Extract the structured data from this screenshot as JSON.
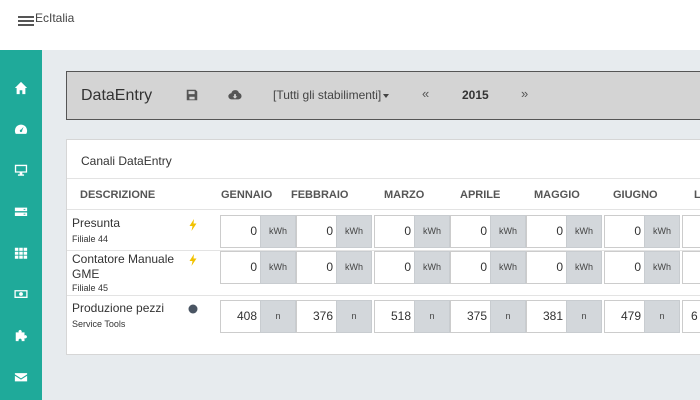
{
  "header": {
    "app_title": "EcItalia"
  },
  "sidebar": {
    "items": [
      {
        "icon": "home-icon"
      },
      {
        "icon": "dashboard-icon"
      },
      {
        "icon": "monitor-icon"
      },
      {
        "icon": "server-icon"
      },
      {
        "icon": "grid-icon"
      },
      {
        "icon": "money-icon"
      },
      {
        "icon": "puzzle-icon"
      },
      {
        "icon": "envelope-icon"
      }
    ]
  },
  "toolbar": {
    "title": "DataEntry",
    "save_icon": "save-icon",
    "download_icon": "cloud-download-icon",
    "plant_select": "[Tutti gli stabilimenti]",
    "prev": "«",
    "year": "2015",
    "next": "»"
  },
  "panel": {
    "title": "Canali DataEntry",
    "columns": [
      "DESCRIZIONE",
      "GENNAIO",
      "FEBBRAIO",
      "MARZO",
      "APRILE",
      "MAGGIO",
      "GIUGNO",
      "L"
    ],
    "rows": [
      {
        "name": "Presunta",
        "sub": "Filiale 44",
        "icon": "lightning-icon",
        "unit": "kWh",
        "values": [
          "0",
          "0",
          "0",
          "0",
          "0",
          "0"
        ]
      },
      {
        "name": "Contatore Manuale GME",
        "sub": "Filiale 45",
        "icon": "lightning-icon",
        "unit": "kWh",
        "values": [
          "0",
          "0",
          "0",
          "0",
          "0",
          "0"
        ]
      },
      {
        "name": "Produzione pezzi",
        "sub": "Service Tools",
        "icon": "circle-icon",
        "unit": "n",
        "values": [
          "408",
          "376",
          "518",
          "375",
          "381",
          "479",
          "6"
        ]
      }
    ]
  },
  "colors": {
    "sidebar": "#1faa9a",
    "lightning": "#f2c200",
    "circle": "#4a5563"
  }
}
